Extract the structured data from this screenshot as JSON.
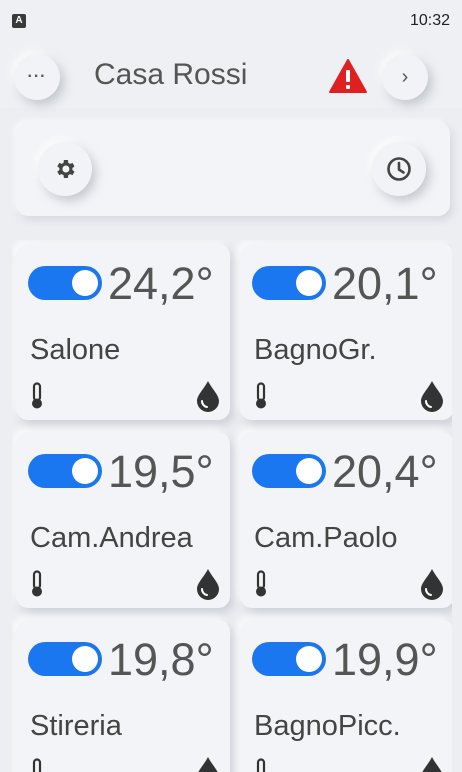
{
  "status_bar": {
    "notification_glyph": "A",
    "time": "10:32"
  },
  "header": {
    "menu_label": "···",
    "title": "Casa Rossi",
    "next_label": "›",
    "alarm_icon": "warning-triangle-icon",
    "alarm_color": "#e02020"
  },
  "toolbar": {
    "settings_icon": "gear-icon",
    "schedule_icon": "clock-icon"
  },
  "accent_color": "#1b77f0",
  "rooms": [
    {
      "name": "Salone",
      "temperature": "24,2°",
      "enabled": true
    },
    {
      "name": "BagnoGr.",
      "temperature": "20,1°",
      "enabled": true
    },
    {
      "name": "Cam.Andrea",
      "temperature": "19,5°",
      "enabled": true
    },
    {
      "name": "Cam.Paolo",
      "temperature": "20,4°",
      "enabled": true
    },
    {
      "name": "Stireria",
      "temperature": "19,8°",
      "enabled": true
    },
    {
      "name": "BagnoPicc.",
      "temperature": "19,9°",
      "enabled": true
    }
  ]
}
